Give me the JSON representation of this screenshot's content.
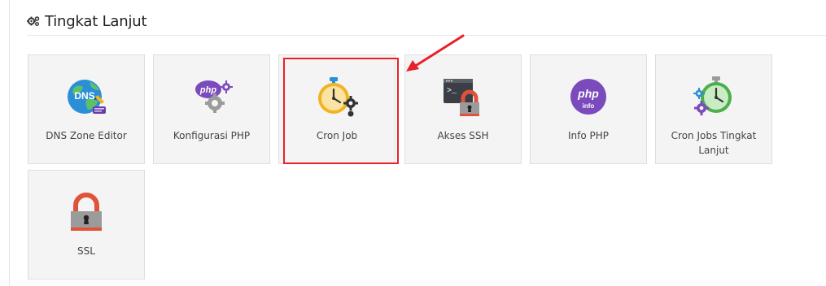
{
  "section": {
    "title": "Tingkat Lanjut",
    "icon": "gears-icon"
  },
  "tiles": [
    {
      "label": "DNS Zone Editor",
      "icon": "dns-globe-icon",
      "selected": false
    },
    {
      "label": "Konfigurasi PHP",
      "icon": "php-config-icon",
      "selected": false
    },
    {
      "label": "Cron Job",
      "icon": "stopwatch-gear-icon",
      "selected": true
    },
    {
      "label": "Akses SSH",
      "icon": "terminal-lock-icon",
      "selected": false
    },
    {
      "label": "Info PHP",
      "icon": "php-info-icon",
      "selected": false
    },
    {
      "label": "Cron Jobs Tingkat Lanjut",
      "icon": "advanced-stopwatch-icon",
      "selected": false
    },
    {
      "label": "SSL",
      "icon": "padlock-icon",
      "selected": false
    }
  ],
  "annotation": {
    "color": "#e8202a"
  }
}
